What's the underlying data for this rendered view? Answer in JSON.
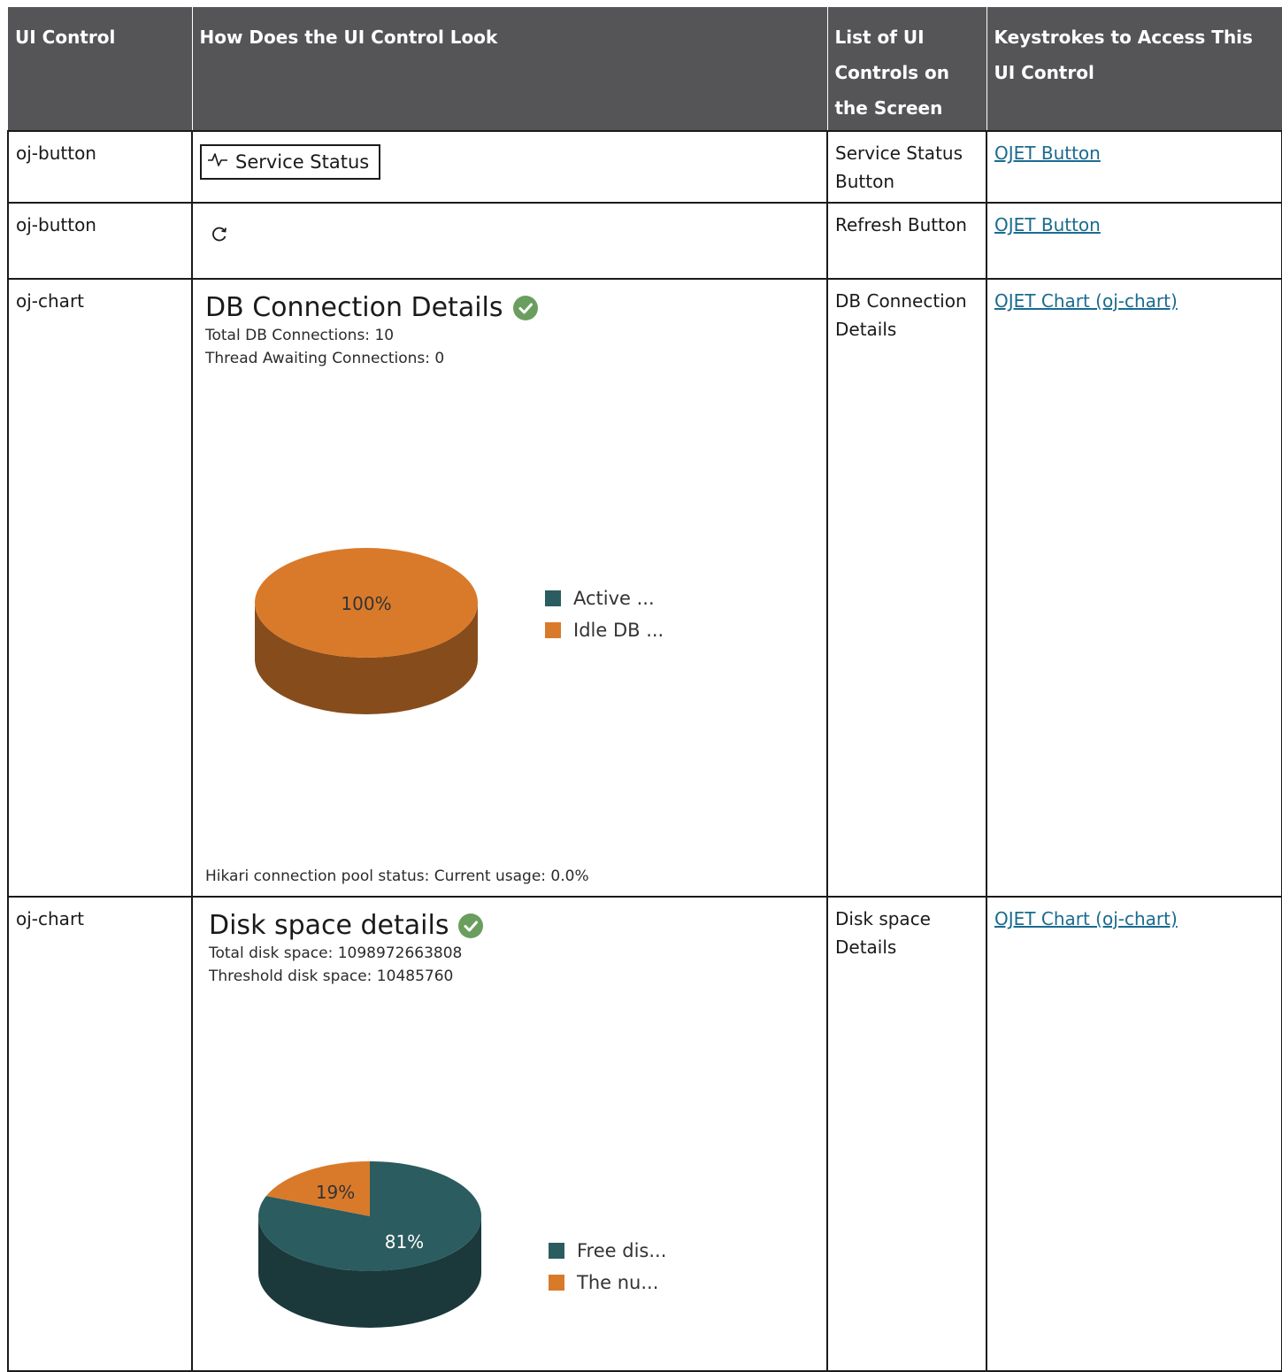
{
  "headers": [
    "UI Control",
    "How Does the UI Control Look",
    "List of UI Controls on the Screen",
    "Keystrokes to Access This UI Control"
  ],
  "rows": [
    {
      "control": "oj-button",
      "button_label": "Service Status",
      "list": "Service Status Button",
      "link": "OJET Button"
    },
    {
      "control": "oj-button",
      "list": "Refresh Button",
      "link": "OJET Button"
    },
    {
      "control": "oj-chart",
      "list": "DB Connection Details",
      "link": "OJET Chart (oj-chart)",
      "title": "DB Connection Details",
      "lines": [
        "Total DB Connections: 10",
        "Thread Awaiting Connections: 0"
      ],
      "footer": "Hikari connection pool status: Current usage: 0.0%"
    },
    {
      "control": "oj-chart",
      "list": "Disk space Details",
      "link": "OJET Chart (oj-chart)",
      "title": "Disk space details",
      "lines": [
        "Total disk space: 1098972663808",
        "Threshold disk space: 10485760"
      ]
    }
  ],
  "colors": {
    "header_bg": "#555557",
    "teal": "#2b5c5f",
    "orange": "#d97a2b",
    "check_green": "#6a9e5e",
    "link": "#1a6b8f"
  },
  "icons": {
    "service": "activity-pulse-icon",
    "refresh": "refresh-icon",
    "ok": "check-circle-icon"
  },
  "chart_data": [
    {
      "type": "pie",
      "title": "DB Connection Details",
      "categories": [
        "Active ...",
        "Idle DB ..."
      ],
      "values": [
        0,
        100
      ],
      "labels": [
        "",
        "100%"
      ],
      "colors": [
        "#2b5c5f",
        "#d97a2b"
      ],
      "legend": "right"
    },
    {
      "type": "pie",
      "title": "Disk space details",
      "categories": [
        "Free dis...",
        "The nu..."
      ],
      "values": [
        81,
        19
      ],
      "labels": [
        "81%",
        "19%"
      ],
      "colors": [
        "#2b5c5f",
        "#d97a2b"
      ],
      "legend": "right"
    }
  ]
}
